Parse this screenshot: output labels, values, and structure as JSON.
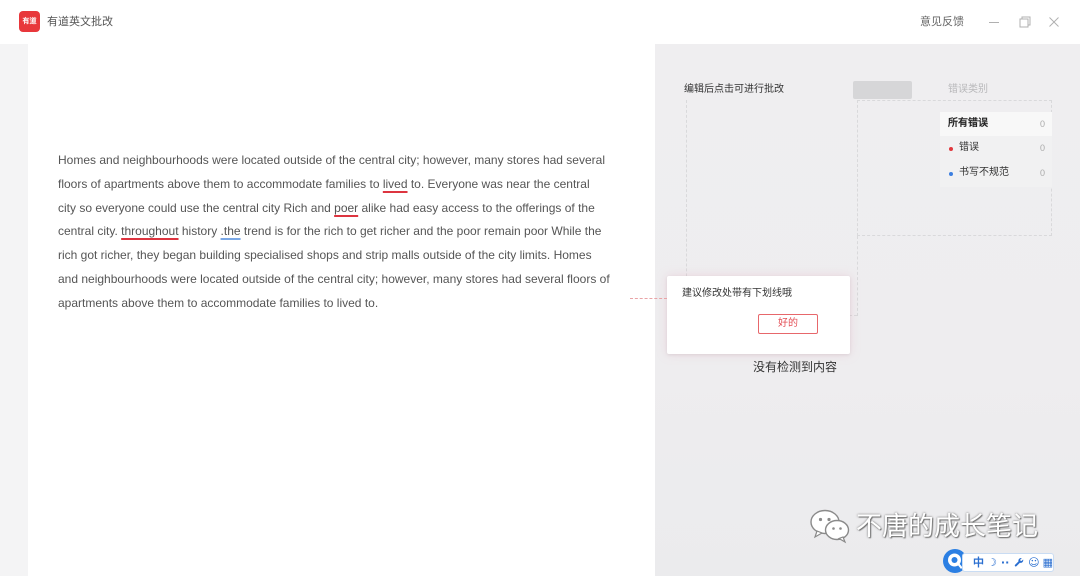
{
  "app": {
    "logo_text": "有道",
    "title": "有道英文批改",
    "feedback_label": "意见反馈",
    "window_controls": [
      "minimize-icon",
      "restore-icon",
      "close-icon"
    ]
  },
  "essay": {
    "lines": [
      [
        {
          "text": "Homes and neighbourhoods were located outside of the central city; however, many stores had several"
        }
      ],
      [
        {
          "text": "floors of apartments above them to accommodate families to "
        },
        {
          "text": "lived",
          "underline_color": "#dd3540"
        },
        {
          "text": " to. Everyone was near the central"
        }
      ],
      [
        {
          "text": "city so everyone could use the central city Rich and "
        },
        {
          "text": "poer",
          "underline_color": "#dd3540"
        },
        {
          "text": " alike had easy access to the offerings of the"
        }
      ],
      [
        {
          "text": "central city. "
        },
        {
          "text": "throughout",
          "underline_color": "#dd3540"
        },
        {
          "text": " history "
        },
        {
          "text": ".the",
          "underline_color": "#7aa8e6"
        },
        {
          "text": " trend is for the rich to get richer and the poor remain poor While the"
        }
      ],
      [
        {
          "text": "rich got richer, they began building specialised shops and strip malls outside of the city limits. Homes"
        }
      ],
      [
        {
          "text": "and neighbourhoods were located outside of the central city; however, many stores had several floors of"
        }
      ],
      [
        {
          "text": "apartments above them to accommodate families to lived to."
        }
      ]
    ]
  },
  "sidebar": {
    "hint": "编辑后点击可进行批改",
    "category_title": "错误类别",
    "categories": [
      {
        "label": "所有错误",
        "count": "0"
      },
      {
        "label": "错误",
        "count": "0",
        "dot_color": "#e0383e"
      },
      {
        "label": "书写不规范",
        "count": "0",
        "dot_color": "#3d7fe0"
      }
    ],
    "empty_text": "没有检测到内容"
  },
  "guide": {
    "message": "建议修改处带有下划线哦",
    "ok_label": "好的"
  },
  "watermark": {
    "icon": "wechat-icon",
    "text": "不唐的成长笔记"
  },
  "ime": {
    "mode": "中",
    "icons": [
      "ime-logo-icon",
      "moon-icon",
      "punctuation-icon",
      "wrench-icon",
      "smiley-icon",
      "grid-icon"
    ]
  },
  "colors": {
    "brand_red": "#e8373b",
    "error_red": "#dd3540",
    "style_blue": "#7aa8e6",
    "ime_blue": "#2b7fe3"
  }
}
